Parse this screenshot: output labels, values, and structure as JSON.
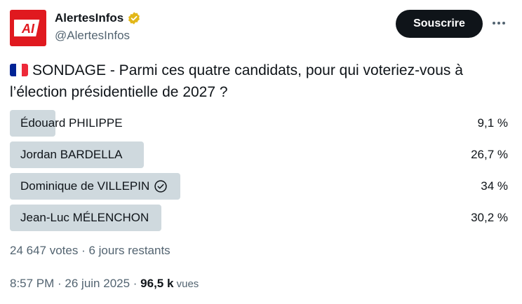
{
  "author": {
    "display_name": "AlertesInfos",
    "handle": "@AlertesInfos",
    "avatar_text": "AI",
    "verified": true
  },
  "header": {
    "follow_label": "Souscrire"
  },
  "tweet": {
    "flag": "france-flag",
    "text": "SONDAGE - Parmi ces quatre candidats, pour qui voteriez-vous à l’élection présidentielle de 2027 ?"
  },
  "poll": {
    "options": [
      {
        "label": "Édouard PHILIPPE",
        "percent_text": "9,1 %",
        "percent": 9.1,
        "selected": false
      },
      {
        "label": "Jordan BARDELLA",
        "percent_text": "26,7 %",
        "percent": 26.7,
        "selected": false
      },
      {
        "label": "Dominique de VILLEPIN",
        "percent_text": "34 %",
        "percent": 34,
        "selected": true
      },
      {
        "label": "Jean-Luc MÉLENCHON",
        "percent_text": "30,2 %",
        "percent": 30.2,
        "selected": false
      }
    ],
    "meta": "24 647 votes · 6 jours restants"
  },
  "footer": {
    "time": "8:57 PM · 26 juin 2025 · ",
    "views_count": "96,5 k",
    "views_label": " vues"
  },
  "colors": {
    "bar": "#cfd9de",
    "avatar_bg": "#e0191f",
    "verified_badge": "#e2b719",
    "secondary_text": "#536471"
  }
}
